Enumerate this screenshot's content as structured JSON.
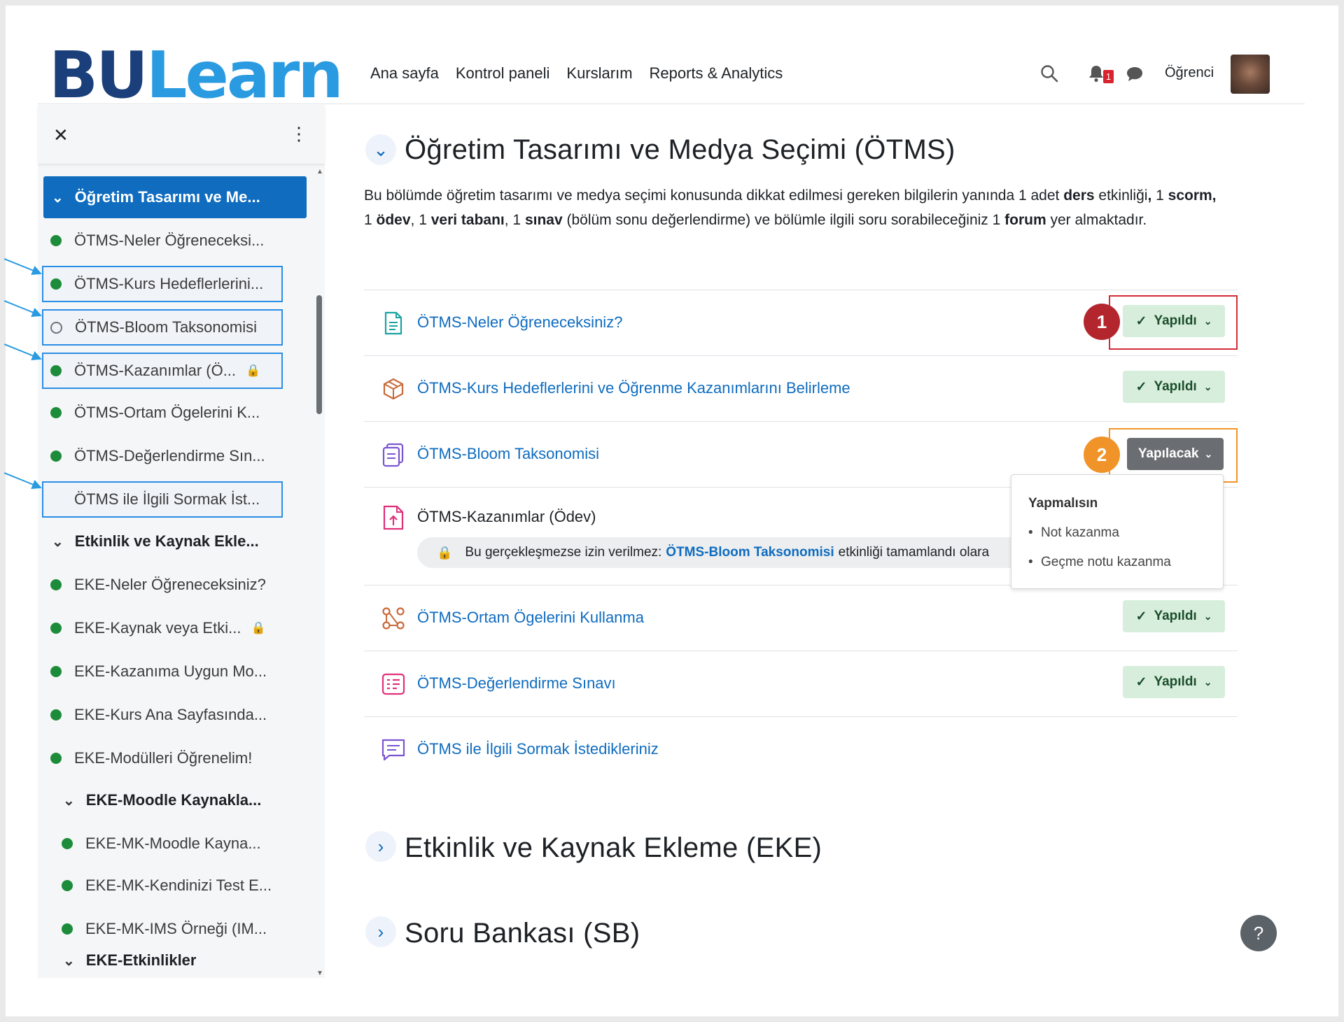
{
  "header": {
    "logo_bu": "BU",
    "logo_learn": "Learn",
    "nav": [
      "Ana sayfa",
      "Kontrol paneli",
      "Kurslarım",
      "Reports & Analytics"
    ],
    "notification_count": "1",
    "user_name": "Öğrenci"
  },
  "drawer": {
    "items": [
      {
        "label": "Öğretim Tasarımı ve Me...",
        "type": "section-active"
      },
      {
        "label": "ÖTMS-Neler Öğreneceksi...",
        "status": "done"
      },
      {
        "label": "ÖTMS-Kurs Hedeflerlerini...",
        "status": "done"
      },
      {
        "label": "ÖTMS-Bloom Taksonomisi",
        "status": "todo"
      },
      {
        "label": "ÖTMS-Kazanımlar (Ö...",
        "status": "done-locked"
      },
      {
        "label": "ÖTMS-Ortam Ögelerini K...",
        "status": "done"
      },
      {
        "label": "ÖTMS-Değerlendirme Sın...",
        "status": "done"
      },
      {
        "label": "ÖTMS ile İlgili Sormak İst...",
        "status": "none"
      },
      {
        "label": "Etkinlik ve Kaynak Ekle...",
        "type": "section"
      },
      {
        "label": "EKE-Neler Öğreneceksiniz?",
        "status": "done"
      },
      {
        "label": "EKE-Kaynak veya Etki...",
        "status": "done-locked"
      },
      {
        "label": "EKE-Kazanıma Uygun Mo...",
        "status": "done"
      },
      {
        "label": "EKE-Kurs Ana Sayfasında...",
        "status": "done"
      },
      {
        "label": "EKE-Modülleri Öğrenelim!",
        "status": "done"
      },
      {
        "label": "EKE-Moodle Kaynakla...",
        "type": "subsection"
      },
      {
        "label": "EKE-MK-Moodle Kayna...",
        "status": "done"
      },
      {
        "label": "EKE-MK-Kendinizi Test E...",
        "status": "done"
      },
      {
        "label": "EKE-MK-IMS Örneği (IM...",
        "status": "done"
      },
      {
        "label": "EKE-Etkinlikler",
        "type": "subsection"
      }
    ]
  },
  "main": {
    "section_title": "Öğretim Tasarımı ve Medya Seçimi (ÖTMS)",
    "summary": {
      "p1": "Bu bölümde öğretim tasarımı ve medya seçimi konusunda dikkat edilmesi gereken bilgilerin yanında  1 adet ",
      "b1": "ders",
      "p2": " etkinliği",
      "b2": ",",
      "p3": " 1 ",
      "b3": "scorm,",
      "p4": " 1 ",
      "b4": "ödev",
      "p5": ", 1 ",
      "b5": "veri tabanı",
      "p6": ", 1 ",
      "b6": "sınav",
      "p7": " (bölüm sonu değerlendirme) ve bölümle ilgili soru sorabileceğiniz 1 ",
      "b7": "forum",
      "p8": " yer almaktadır."
    },
    "activities": [
      {
        "name": "ÖTMS-Neler Öğreneceksiniz?",
        "icon": "page-icon",
        "status": "Yapıldı"
      },
      {
        "name": "ÖTMS-Kurs Hedeflerlerini ve Öğrenme Kazanımlarını Belirleme",
        "icon": "scorm-package-icon",
        "status": "Yapıldı"
      },
      {
        "name": "ÖTMS-Bloom Taksonomisi",
        "icon": "lesson-icon",
        "status": "Yapılacak"
      },
      {
        "name": "ÖTMS-Kazanımlar (Ödev)",
        "icon": "assignment-icon",
        "status": ""
      },
      {
        "name": "ÖTMS-Ortam Ögelerini Kullanma",
        "icon": "database-icon",
        "status": "Yapıldı"
      },
      {
        "name": "ÖTMS-Değerlendirme Sınavı",
        "icon": "quiz-icon",
        "status": "Yapıldı"
      },
      {
        "name": "ÖTMS ile İlgili Sormak İstedikleriniz",
        "icon": "forum-icon",
        "status": ""
      }
    ],
    "restriction": {
      "prefix": "Bu gerçekleşmezse izin verilmez:",
      "link": "ÖTMS-Bloom Taksonomisi",
      "suffix": "etkinliği tamamlandı olara"
    },
    "popover": {
      "title": "Yapmalısın",
      "items": [
        "Not kazanma",
        "Geçme notu kazanma"
      ]
    },
    "other_sections": [
      "Etkinlik ve Kaynak Ekleme (EKE)",
      "Soru Bankası (SB)"
    ],
    "markers": [
      "1",
      "2"
    ],
    "help_label": "?"
  },
  "colors": {
    "primary": "#0f6cbf",
    "done_bg": "#d7eedc",
    "todo_bg": "#6a6e72",
    "marker1": "#b3262d",
    "marker2": "#f0942a"
  }
}
